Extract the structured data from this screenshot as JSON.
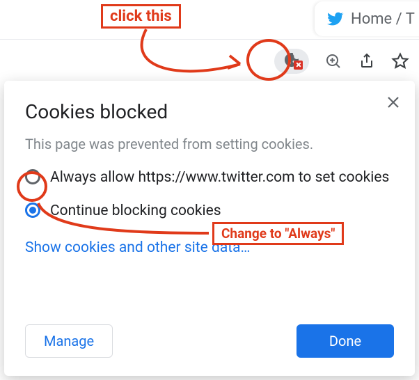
{
  "annotations": {
    "click_this": "click this",
    "change_to_always": "Change to \"Always\""
  },
  "tab": {
    "title": "Home / T"
  },
  "popup": {
    "title": "Cookies blocked",
    "description": "This page was prevented from setting cookies.",
    "option_allow": "Always allow https://www.twitter.com  to set cookies",
    "option_block": "Continue blocking cookies",
    "show_cookies_link": "Show cookies and other site data…",
    "manage_button": "Manage",
    "done_button": "Done"
  },
  "colors": {
    "annotation": "#e03a1a",
    "primary": "#1a73e8"
  }
}
